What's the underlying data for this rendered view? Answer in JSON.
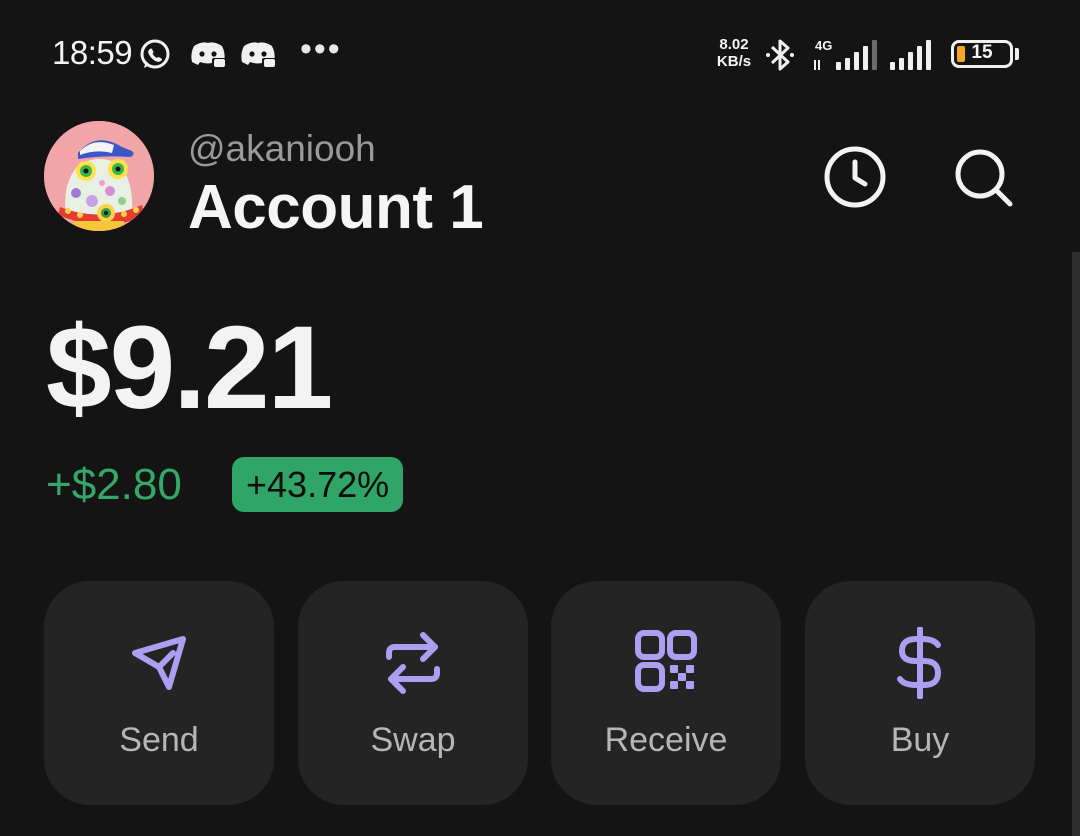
{
  "status_bar": {
    "time": "18:59",
    "notification_icons": [
      "whatsapp-icon",
      "discord-icon",
      "discord-icon"
    ],
    "more": "•••",
    "net_speed_value": "8.02",
    "net_speed_unit": "KB/s",
    "network_type": "4G",
    "battery_level": "15",
    "colors": {
      "battery_low": "#f5a623"
    }
  },
  "header": {
    "handle": "@akaniooh",
    "account_name": "Account 1",
    "icons": [
      "history-clock-icon",
      "search-icon"
    ]
  },
  "balance": {
    "value": "$9.21",
    "change_amount": "+$2.80",
    "change_percent": "+43.72%",
    "colors": {
      "positive": "#34a869",
      "positive_badge": "#2fa667"
    }
  },
  "actions": [
    {
      "label": "Send",
      "icon": "send-paper-plane-icon"
    },
    {
      "label": "Swap",
      "icon": "swap-arrows-icon"
    },
    {
      "label": "Receive",
      "icon": "qr-code-icon"
    },
    {
      "label": "Buy",
      "icon": "dollar-icon"
    }
  ],
  "theme": {
    "background": "#141414",
    "card": "#242424",
    "accent": "#ab9ff2"
  }
}
